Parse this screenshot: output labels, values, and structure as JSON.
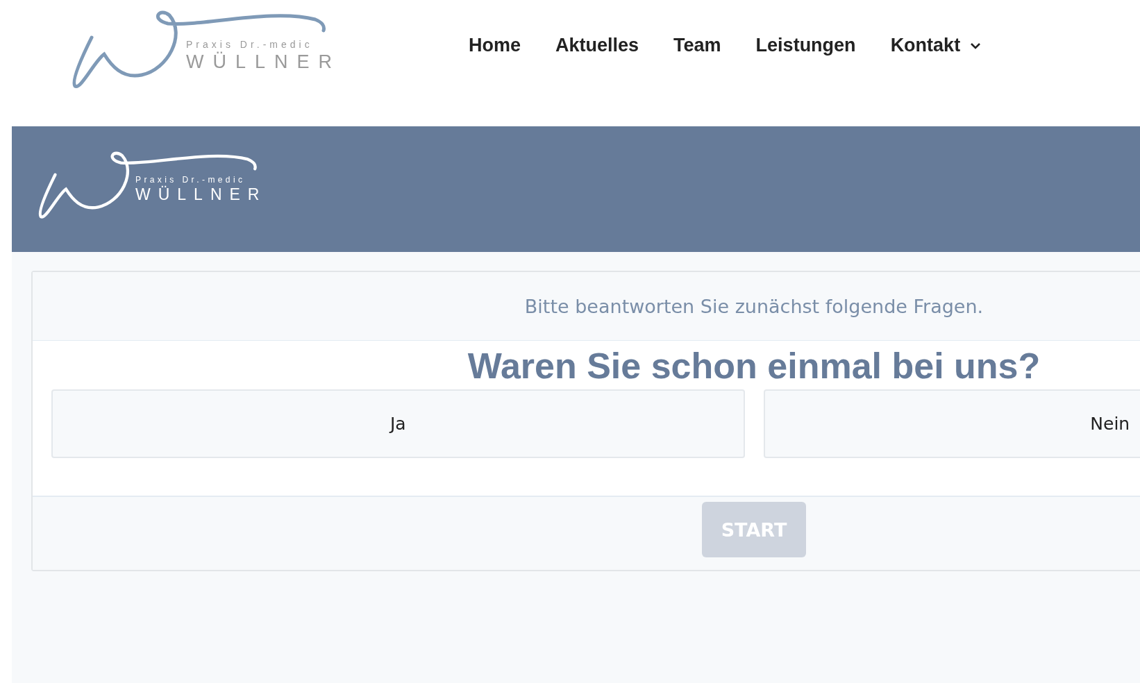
{
  "header": {
    "logo": {
      "line1": "Praxis Dr.-medic",
      "line2": "WÜLLNER"
    },
    "nav": [
      {
        "label": "Home",
        "kind": "link"
      },
      {
        "label": "Aktuelles",
        "kind": "link"
      },
      {
        "label": "Team",
        "kind": "link"
      },
      {
        "label": "Leistungen",
        "kind": "link"
      },
      {
        "label": "Kontakt",
        "kind": "dropdown"
      }
    ]
  },
  "banner": {
    "logo": {
      "line1": "Praxis Dr.-medic",
      "line2": "WÜLLNER"
    }
  },
  "form": {
    "intro": "Bitte beantworten Sie zunächst folgende Fragen.",
    "question": "Waren Sie schon einmal bei uns?",
    "options": [
      {
        "label": "Ja",
        "selected": false
      },
      {
        "label": "Nein",
        "selected": false
      }
    ],
    "start": {
      "label": "START",
      "disabled": true
    }
  }
}
